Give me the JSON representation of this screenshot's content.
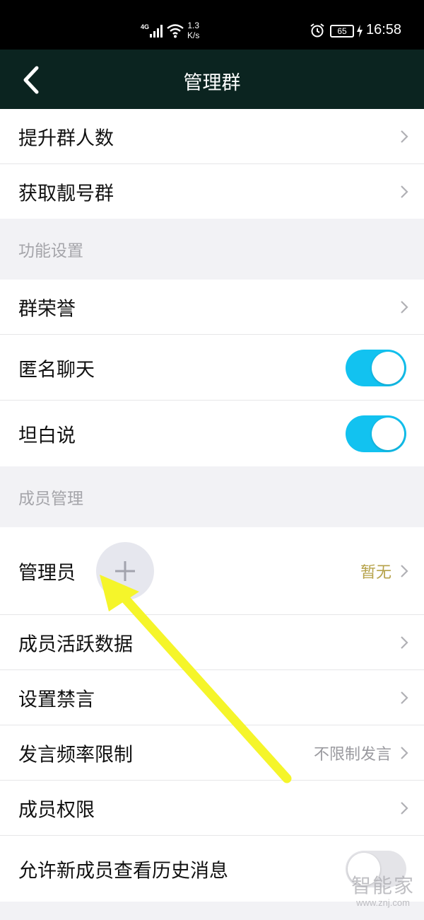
{
  "status_bar": {
    "network": "4G",
    "speed_value": "1.3",
    "speed_unit": "K/s",
    "battery": "65",
    "time": "16:58"
  },
  "header": {
    "title": "管理群"
  },
  "top_items": [
    {
      "label": "提升群人数"
    },
    {
      "label": "获取靓号群"
    }
  ],
  "function_settings": {
    "header": "功能设置",
    "items": [
      {
        "label": "群荣誉"
      },
      {
        "label": "匿名聊天",
        "toggle": true
      },
      {
        "label": "坦白说",
        "toggle": true
      }
    ]
  },
  "member_management": {
    "header": "成员管理",
    "admin": {
      "label": "管理员",
      "value": "暂无"
    },
    "items": [
      {
        "label": "成员活跃数据"
      },
      {
        "label": "设置禁言"
      },
      {
        "label": "发言频率限制",
        "value": "不限制发言"
      },
      {
        "label": "成员权限"
      },
      {
        "label": "允许新成员查看历史消息",
        "toggle": false
      }
    ]
  },
  "colors": {
    "header_bg": "#0b2420",
    "toggle_on": "#12c2f0",
    "value_gold": "#b6a24a",
    "annotation_arrow": "#f5f52a"
  },
  "watermark": {
    "name": "智能家",
    "url": "www.znj.com"
  }
}
